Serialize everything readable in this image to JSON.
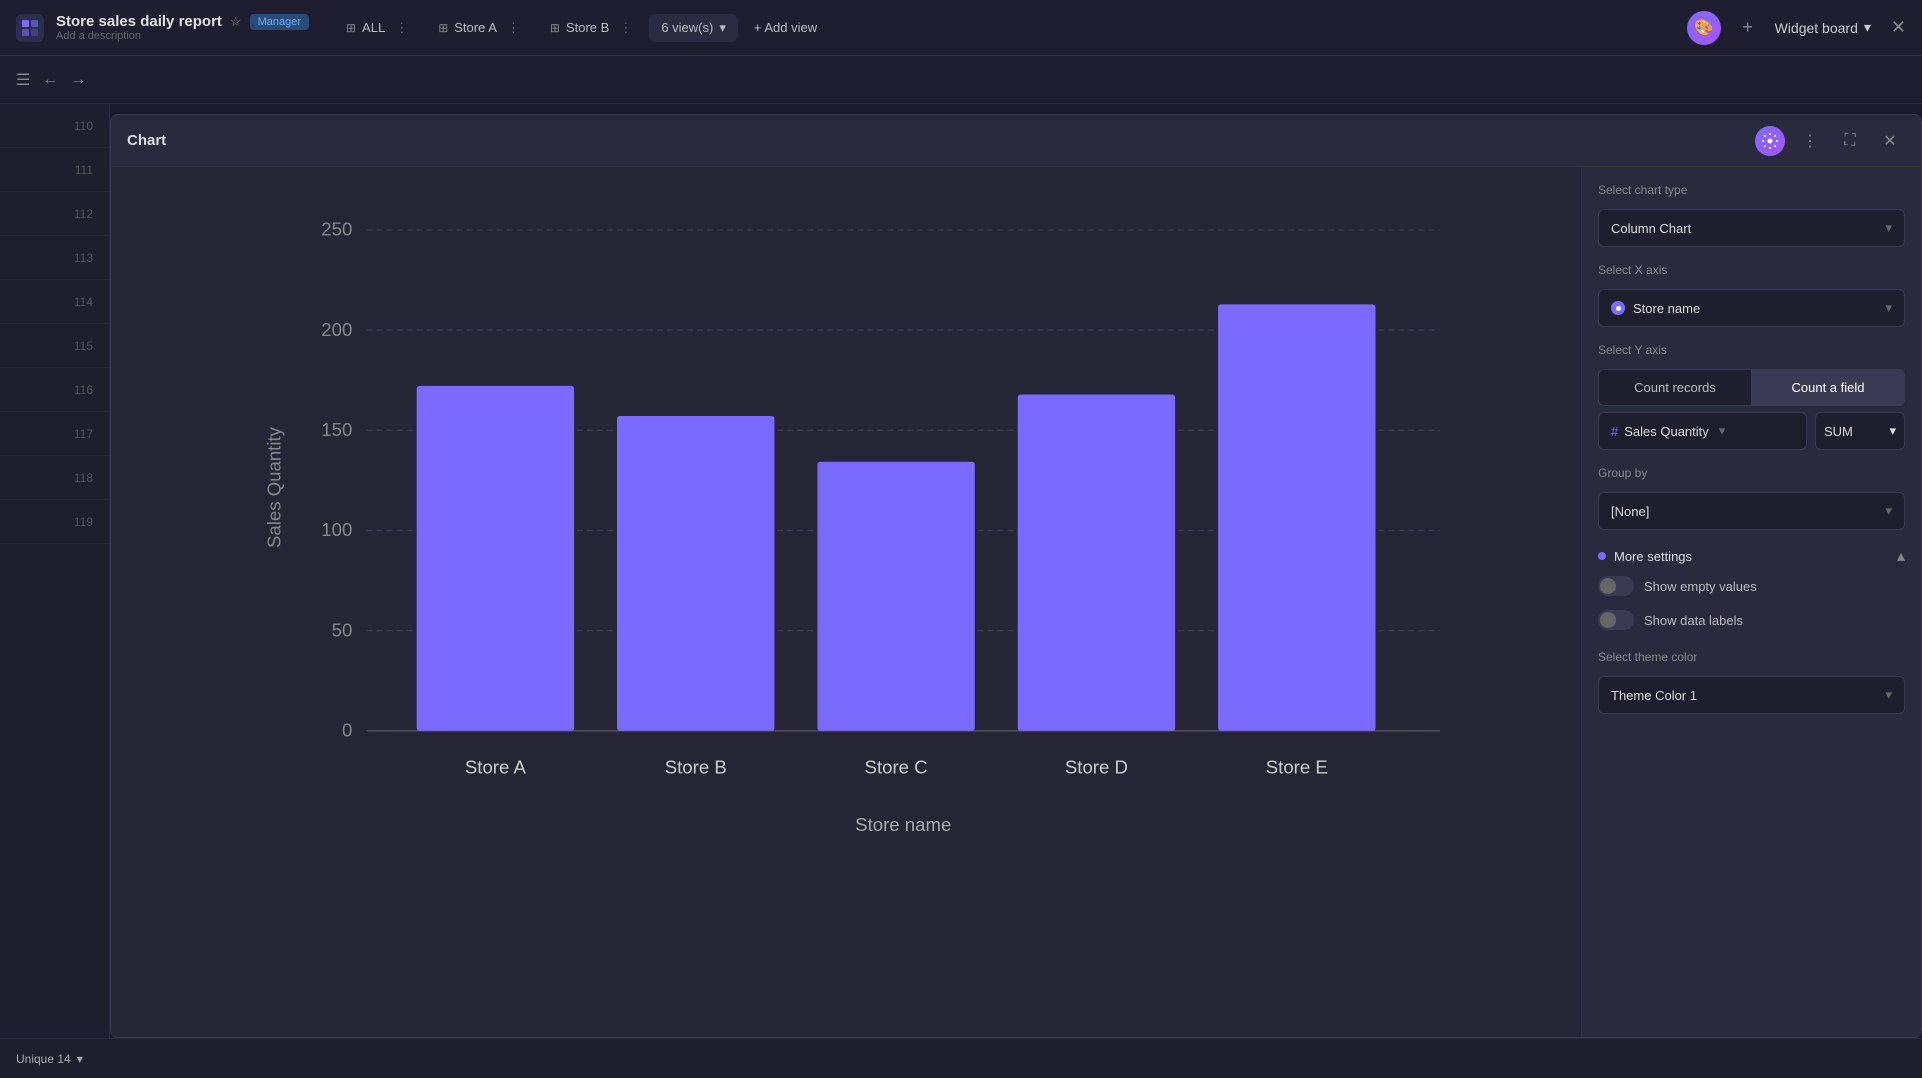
{
  "app": {
    "title": "Store sales daily report",
    "manager_badge": "Manager",
    "subtitle": "Add a description",
    "star": "☆"
  },
  "tabs": [
    {
      "label": "ALL",
      "icon": "⊞",
      "id": "all"
    },
    {
      "label": "Store A",
      "icon": "⊞",
      "id": "store-a"
    },
    {
      "label": "Store B",
      "icon": "⊞",
      "id": "store-b"
    }
  ],
  "views_btn": "6 view(s)",
  "add_view_btn": "+ Add view",
  "widget_board": "Widget board",
  "toolbar": {
    "undo": "←",
    "redo": "→"
  },
  "row_numbers": [
    "110",
    "111",
    "112",
    "113",
    "114",
    "115",
    "116",
    "117",
    "118",
    "119"
  ],
  "modal": {
    "title": "Chart",
    "chart_type_label": "Select chart type",
    "chart_type_value": "Column Chart",
    "x_axis_label": "Select X axis",
    "x_axis_value": "Store name",
    "y_axis_label": "Select Y axis",
    "y_axis_count_records": "Count records",
    "y_axis_count_field": "Count a field",
    "y_axis_active": "count_field",
    "field_name": "Sales Quantity",
    "aggregation": "SUM",
    "group_by_label": "Group by",
    "group_by_value": "[None]",
    "more_settings_label": "More settings",
    "show_empty_values": "Show empty values",
    "show_data_labels": "Show data labels",
    "theme_color_label": "Select theme color",
    "theme_color_value": "Theme Color 1"
  },
  "chart": {
    "x_label": "Store name",
    "y_label": "Sales Quantity",
    "bars": [
      {
        "label": "Store A",
        "value": 172
      },
      {
        "label": "Store B",
        "value": 157
      },
      {
        "label": "Store C",
        "value": 134
      },
      {
        "label": "Store D",
        "value": 168
      },
      {
        "label": "Store E",
        "value": 213
      }
    ],
    "y_ticks": [
      "0",
      "50",
      "100",
      "150",
      "200",
      "250"
    ],
    "bar_color": "#7c6aff",
    "max_value": 250
  },
  "bottom": {
    "unique_label": "Unique 14",
    "chevron": "▾"
  }
}
